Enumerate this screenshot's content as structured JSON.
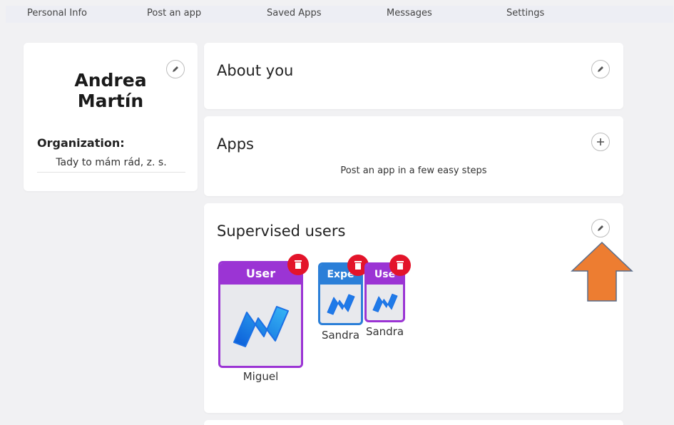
{
  "nav": {
    "items": [
      "Personal Info",
      "Post an app",
      "Saved Apps",
      "Messages",
      "Settings"
    ]
  },
  "profile": {
    "name_line1": "Andrea",
    "name_line2": "Martín",
    "org_label": "Organization:",
    "org_value": "Tady to mám rád, z. s."
  },
  "about": {
    "title": "About you"
  },
  "apps": {
    "title": "Apps",
    "subtitle": "Post an app in a few easy steps"
  },
  "supervised": {
    "title": "Supervised users",
    "users": [
      {
        "role": "User",
        "name": "Miguel",
        "color": "#9b34d4"
      },
      {
        "role": "Expe",
        "name": "Sandra",
        "color": "#2b7fd8"
      },
      {
        "role": "Use",
        "name": "Sandra",
        "color": "#9b34d4"
      }
    ]
  },
  "colors": {
    "accent_purple": "#9b34d4",
    "accent_blue": "#2b7fd8",
    "delete_red": "#e3142a",
    "arrow_orange": "#ed7d31"
  }
}
